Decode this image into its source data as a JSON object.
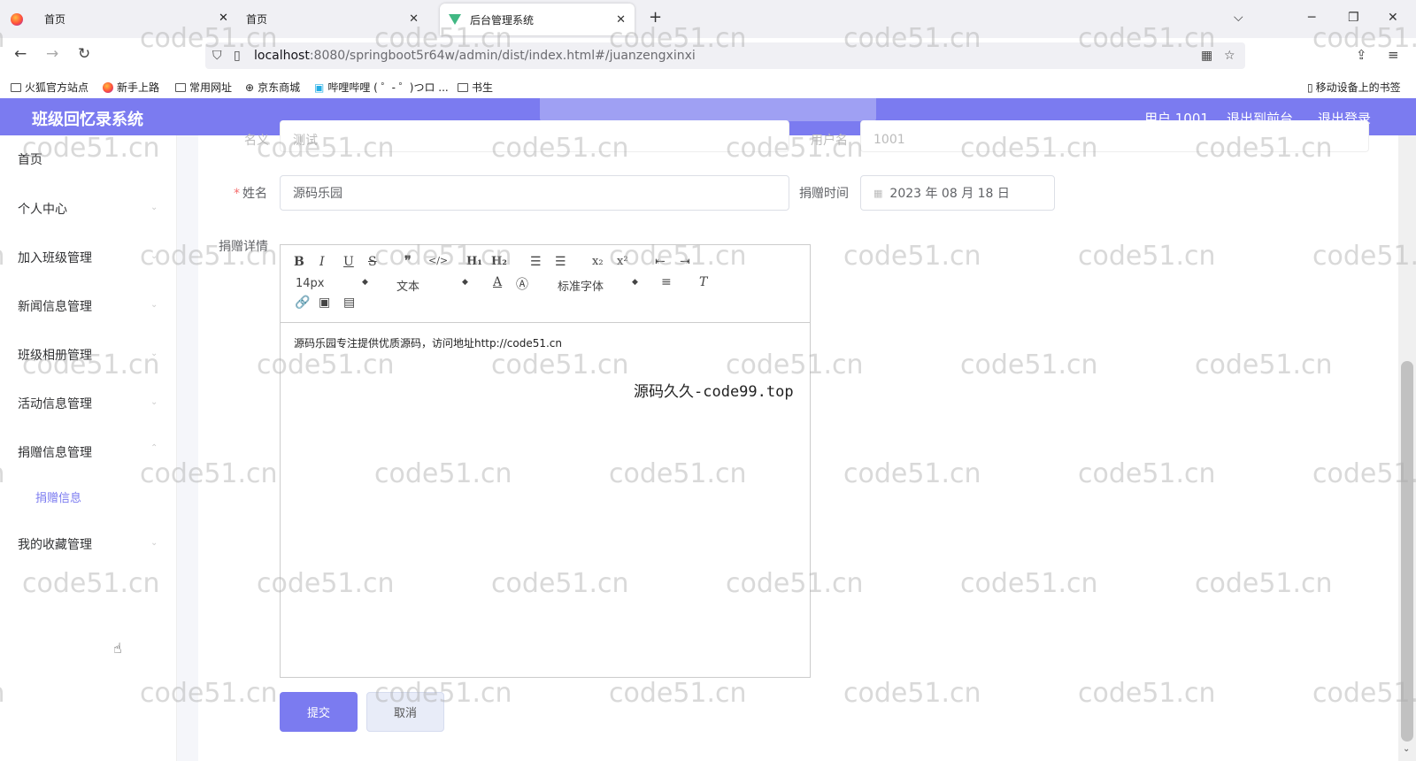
{
  "browser": {
    "tabs": [
      {
        "label": "首页"
      },
      {
        "label": "首页"
      },
      {
        "label": "后台管理系统"
      }
    ],
    "url_host": "localhost",
    "url_path": ":8080/springboot5r64w/admin/dist/index.html#/juanzengxinxi",
    "bookmarks": [
      "火狐官方站点",
      "新手上路",
      "常用网址",
      "京东商城",
      "哔哩哔哩 ( ゜- ゜)つロ ...",
      "书生"
    ],
    "mobile_bookmarks": "移动设备上的书签"
  },
  "header": {
    "title": "班级回忆录系统",
    "user": "用户 1001",
    "to_front": "退出到前台",
    "logout": "退出登录"
  },
  "sidebar": {
    "items": [
      {
        "label": "首页"
      },
      {
        "label": "个人中心"
      },
      {
        "label": "加入班级管理"
      },
      {
        "label": "新闻信息管理"
      },
      {
        "label": "班级相册管理"
      },
      {
        "label": "活动信息管理"
      },
      {
        "label": "捐赠信息管理"
      },
      {
        "label": "我的收藏管理"
      }
    ],
    "sub_item": "捐赠信息"
  },
  "form": {
    "top_label_left": "名义",
    "top_value_left": "测试",
    "top_label_right": "用户名",
    "top_value_right": "1001",
    "name_label": "姓名",
    "name_value": "源码乐园",
    "time_label": "捐赠时间",
    "time_value": "2023 年 08 月 18 日",
    "detail_label": "捐赠详情"
  },
  "editor": {
    "font_size": "14px",
    "text_type": "文本",
    "font_family": "标准字体",
    "content": "源码乐园专注提供优质源码，访问地址http://code51.cn"
  },
  "buttons": {
    "submit": "提交",
    "cancel": "取消"
  },
  "watermarks": {
    "text": "code51.cn",
    "overlay": "源码久久-code99.top"
  },
  "colors": {
    "accent": "#7b7bf0",
    "header_bg": "#7b7bf0"
  }
}
